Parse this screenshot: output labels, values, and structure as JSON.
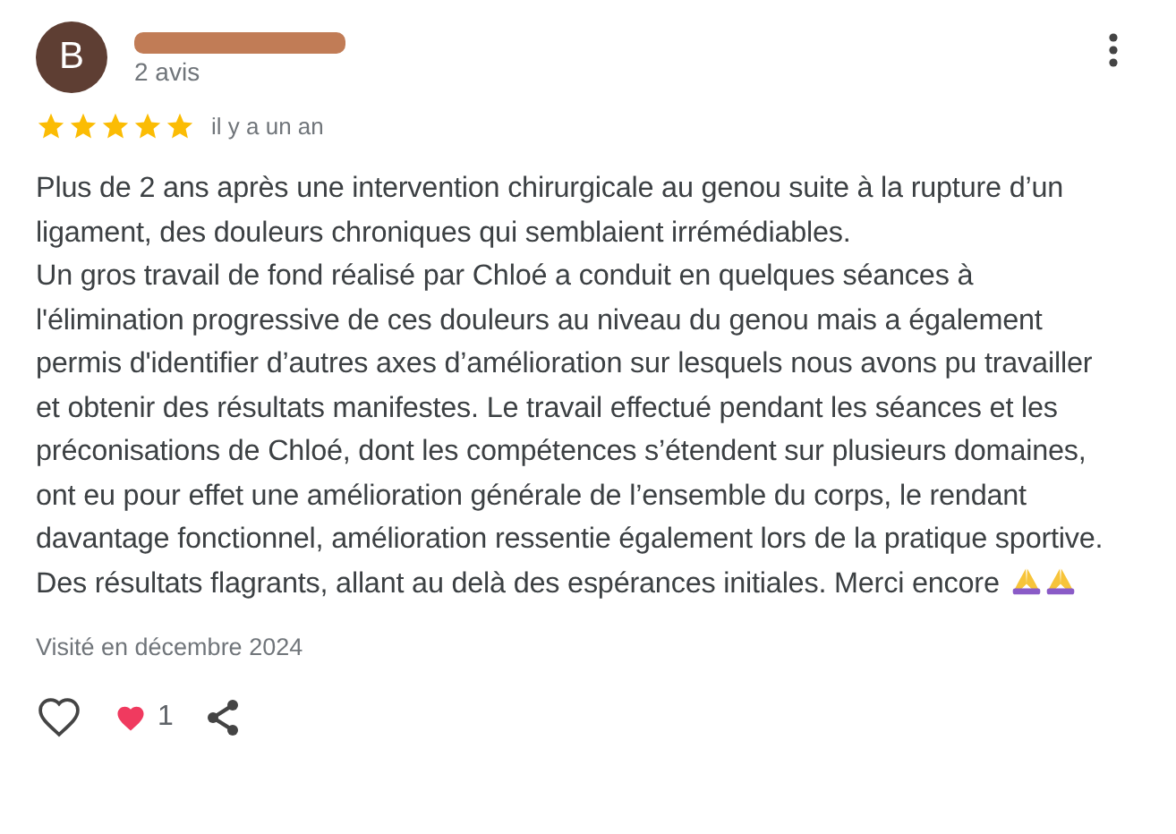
{
  "review": {
    "avatar_letter": "B",
    "reviewer_count": "2 avis",
    "stars": 5,
    "date": "il y a un an",
    "text": "Plus de 2 ans après une intervention chirurgicale au genou suite à la rupture d’un ligament, des douleurs chroniques qui semblaient irrémédiables.\nUn gros travail de fond réalisé par Chloé a conduit en quelques séances à l'élimination progressive de ces douleurs au niveau du genou mais a également permis d'identifier d’autres axes d’amélioration sur lesquels nous avons pu travailler et obtenir des résultats manifestes. Le travail effectué pendant les séances et les préconisations de Chloé, dont les compétences s’étendent sur plusieurs domaines, ont eu pour effet une amélioration générale de l’ensemble du corps, le rendant davantage fonctionnel, amélioration ressentie également lors de la pratique sportive. Des résultats flagrants, allant au delà des espérances initiales. Merci encore",
    "visit": "Visité en décembre 2024",
    "reaction_count": "1"
  }
}
